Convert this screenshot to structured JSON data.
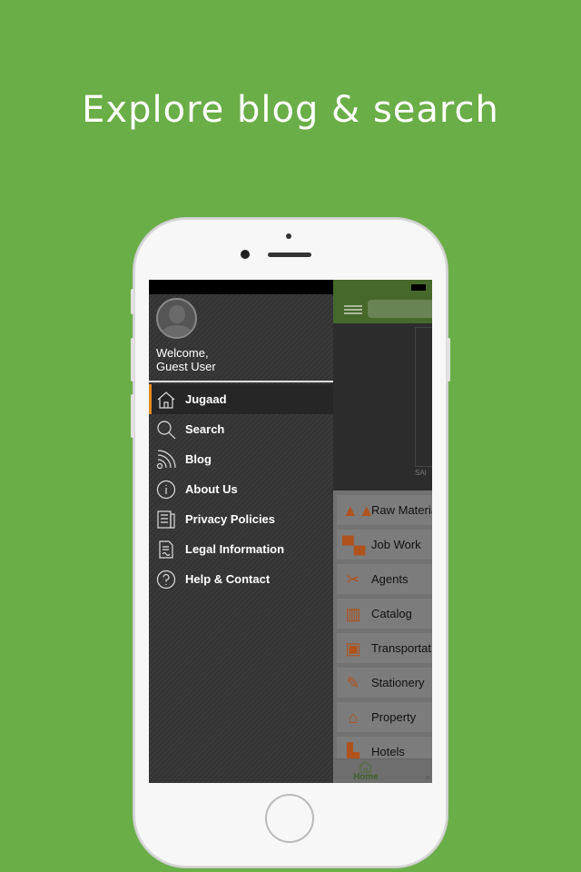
{
  "headline": "Explore blog & search",
  "drawer": {
    "welcome_line1": "Welcome,",
    "welcome_line2": "Guest User",
    "items": [
      {
        "label": "Jugaad",
        "icon": "home-icon",
        "active": true
      },
      {
        "label": "Search",
        "icon": "search-icon"
      },
      {
        "label": "Blog",
        "icon": "rss-icon"
      },
      {
        "label": "About Us",
        "icon": "info-icon"
      },
      {
        "label": "Privacy Policies",
        "icon": "document-icon"
      },
      {
        "label": "Legal Information",
        "icon": "certificate-icon"
      },
      {
        "label": "Help & Contact",
        "icon": "help-icon"
      }
    ]
  },
  "categories": [
    {
      "label": "Raw Materia",
      "icon": "raw-materials-icon"
    },
    {
      "label": "Job Work",
      "icon": "sewing-machine-icon"
    },
    {
      "label": "Agents",
      "icon": "scissors-icon"
    },
    {
      "label": "Catalog",
      "icon": "book-icon"
    },
    {
      "label": "Transportat",
      "icon": "truck-icon"
    },
    {
      "label": "Stationery",
      "icon": "pen-icon"
    },
    {
      "label": "Property",
      "icon": "house-icon"
    },
    {
      "label": "Hotels",
      "icon": "hotel-icon"
    }
  ],
  "content": {
    "partial_label": "SAI"
  },
  "tabbar": {
    "home": "Home",
    "next_partial": "P"
  },
  "colors": {
    "background": "#6aae48",
    "accent": "#e58a1e",
    "header": "#46682a",
    "category_icon": "#b0521c"
  }
}
